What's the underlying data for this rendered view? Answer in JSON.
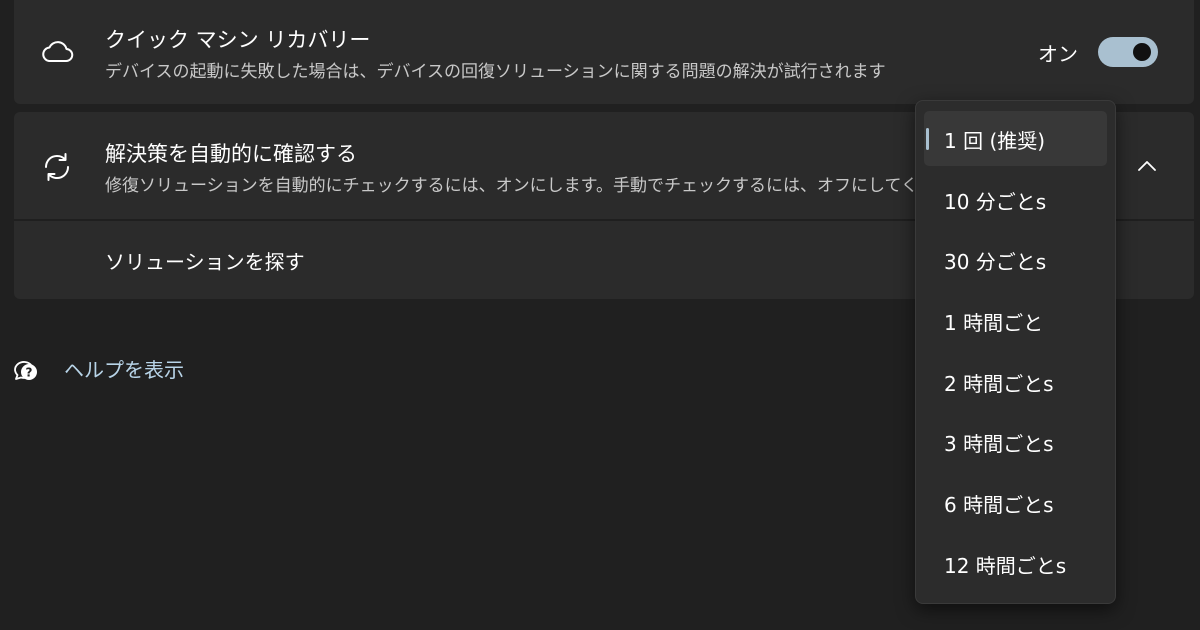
{
  "quick_recovery": {
    "icon": "cloud-icon",
    "title": "クイック マシン リカバリー",
    "description": "デバイスの起動に失敗した場合は、デバイスの回復ソリューションに関する問題の解決が試行されます",
    "toggle_label": "オン",
    "toggle_on": true
  },
  "auto_check": {
    "icon": "sync-icon",
    "title": "解決策を自動的に確認する",
    "description": "修復ソリューションを自動的にチェックするには、オンにします。手動でチェックするには、オフにしてください",
    "expanded": true,
    "sub_label": "ソリューションを探す"
  },
  "help": {
    "label": "ヘルプを表示",
    "icon": "help-chat-icon"
  },
  "dropdown": {
    "selected_index": 0,
    "options": [
      "1 回 (推奨)",
      "10 分ごとs",
      "30 分ごとs",
      "1 時間ごと",
      "2 時間ごとs",
      "3 時間ごとs",
      "6 時間ごとs",
      "12 時間ごとs"
    ]
  },
  "colors": {
    "background": "#202020",
    "card": "#2b2b2b",
    "accent": "#a9c0d0",
    "link": "#b8d4e8"
  }
}
